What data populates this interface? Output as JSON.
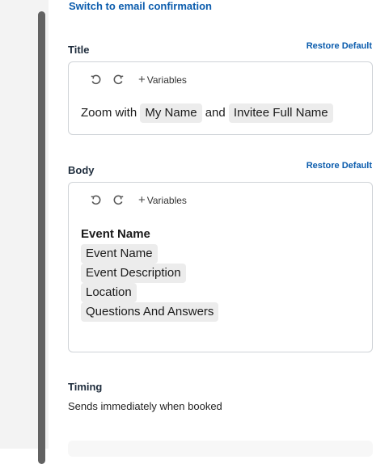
{
  "switch_link": "Switch to email confirmation",
  "title_section": {
    "label": "Title",
    "restore": "Restore Default",
    "toolbar": {
      "variables": "Variables"
    },
    "content": {
      "text_prefix": "Zoom with",
      "chip_1": "My Name",
      "text_middle": "and",
      "chip_2": "Invitee Full Name"
    }
  },
  "body_section": {
    "label": "Body",
    "restore": "Restore Default",
    "toolbar": {
      "variables": "Variables"
    },
    "content": {
      "heading": "Event Name",
      "chips": [
        "Event Name",
        "Event Description",
        "Location",
        "Questions And Answers"
      ]
    }
  },
  "timing": {
    "label": "Timing",
    "text": "Sends immediately when booked"
  },
  "icons": {
    "undo": "undo-icon",
    "redo": "redo-icon",
    "plus": "plus-icon"
  },
  "colors": {
    "link": "#0b5cad",
    "chip_bg": "#ececec",
    "border": "#cfd3d7"
  }
}
